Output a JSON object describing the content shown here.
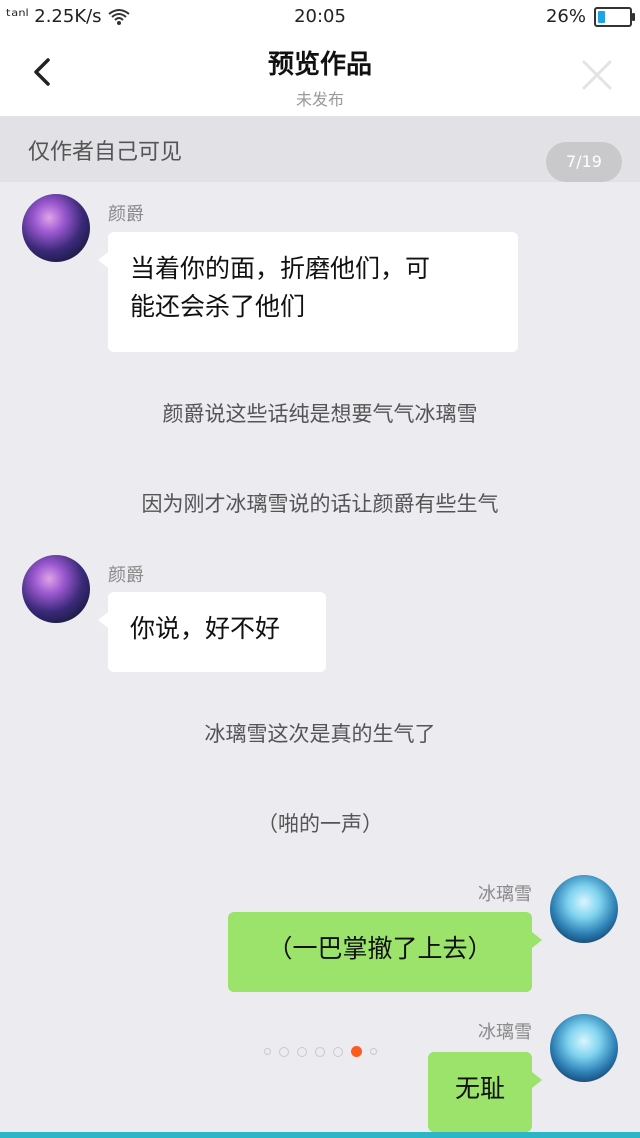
{
  "status_bar": {
    "signal_text": "ᵗᵃⁿˡ 2.25K/s",
    "time": "20:05",
    "battery_percent": "26%",
    "battery_level": 0.26,
    "battery_color": "#1fa3e8"
  },
  "header": {
    "title": "预览作品",
    "subtitle": "未发布",
    "back_icon": "chevron-left-icon",
    "close_icon": "close-icon"
  },
  "visibility": {
    "text": "仅作者自己可见",
    "page_counter": "7/19"
  },
  "messages": [
    {
      "sender": "颜爵",
      "text_line1": "当着你的面，折磨他们，可",
      "text_line2": "能还会杀了他们"
    },
    {
      "narration": "颜爵说这些话纯是想要气气冰璃雪"
    },
    {
      "narration": "因为刚才冰璃雪说的话让颜爵有些生气"
    },
    {
      "sender": "颜爵",
      "text": "你说，好不好"
    },
    {
      "narration": "冰璃雪这次是真的生气了"
    },
    {
      "narration": "（啪的一声）"
    },
    {
      "sender": "冰璃雪",
      "text": "（一巴掌撤了上去）"
    },
    {
      "sender": "冰璃雪",
      "text": "无耻"
    }
  ],
  "pager": {
    "count": 7,
    "active_index": 5,
    "active_color": "#ff5a1f"
  },
  "colors": {
    "accent_green": "#9be36a",
    "bottom_line": "#2ab6c7"
  }
}
